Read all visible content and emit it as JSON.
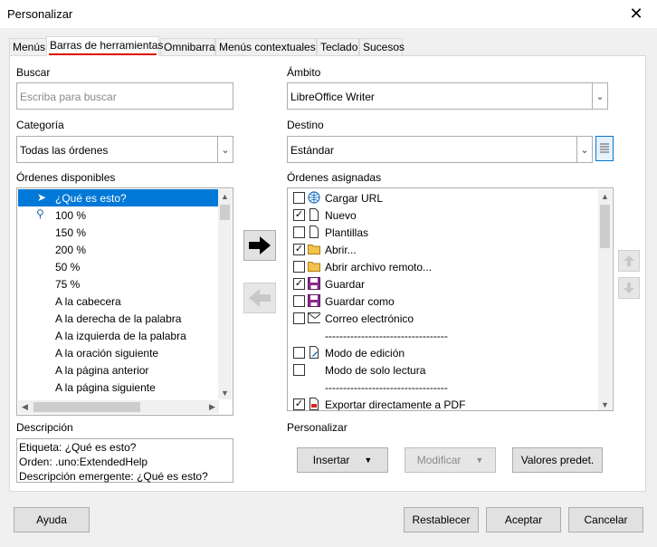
{
  "window": {
    "title": "Personalizar"
  },
  "tabs": [
    {
      "label": "Menús"
    },
    {
      "label": "Barras de herramientas"
    },
    {
      "label": "Omnibarra"
    },
    {
      "label": "Menús contextuales"
    },
    {
      "label": "Teclado"
    },
    {
      "label": "Sucesos"
    }
  ],
  "search": {
    "label": "Buscar",
    "placeholder": "Escriba para buscar"
  },
  "category": {
    "label": "Categoría",
    "value": "Todas las órdenes"
  },
  "available": {
    "label": "Órdenes disponibles",
    "items": [
      {
        "label": "¿Qué es esto?"
      },
      {
        "label": "100 %"
      },
      {
        "label": "150 %"
      },
      {
        "label": "200 %"
      },
      {
        "label": "50 %"
      },
      {
        "label": "75 %"
      },
      {
        "label": "A la cabecera"
      },
      {
        "label": "A la derecha de la palabra"
      },
      {
        "label": "A la izquierda de la palabra"
      },
      {
        "label": "A la oración siguiente"
      },
      {
        "label": "A la página anterior"
      },
      {
        "label": "A la página siguiente"
      }
    ]
  },
  "scope": {
    "label": "Ámbito",
    "value": "LibreOffice Writer"
  },
  "target": {
    "label": "Destino",
    "value": "Estándar"
  },
  "assigned": {
    "label": "Órdenes asignadas",
    "items": [
      {
        "label": "Cargar URL",
        "checked": false,
        "icon": "globe-icon"
      },
      {
        "label": "Nuevo",
        "checked": true,
        "icon": "new-document-icon"
      },
      {
        "label": "Plantillas",
        "checked": false,
        "icon": "template-icon"
      },
      {
        "label": "Abrir...",
        "checked": true,
        "icon": "folder-open-icon"
      },
      {
        "label": "Abrir archivo remoto...",
        "checked": false,
        "icon": "remote-folder-icon"
      },
      {
        "label": "Guardar",
        "checked": true,
        "icon": "save-icon"
      },
      {
        "label": "Guardar como",
        "checked": false,
        "icon": "save-as-icon"
      },
      {
        "label": "Correo electrónico",
        "checked": false,
        "icon": "mail-icon"
      },
      {
        "label": "----------------------------------",
        "checked": null,
        "icon": ""
      },
      {
        "label": "Modo de edición",
        "checked": false,
        "icon": "edit-mode-icon"
      },
      {
        "label": "Modo de solo lectura",
        "checked": false,
        "icon": ""
      },
      {
        "label": "----------------------------------",
        "checked": null,
        "icon": ""
      },
      {
        "label": "Exportar directamente a PDF",
        "checked": true,
        "icon": "pdf-icon"
      }
    ]
  },
  "description": {
    "label": "Descripción",
    "lines": [
      "Etiqueta: ¿Qué es esto?",
      "Orden: .uno:ExtendedHelp",
      "Descripción emergente: ¿Qué es esto?"
    ]
  },
  "customize": {
    "label": "Personalizar",
    "insert": "Insertar",
    "modify": "Modificar",
    "defaults": "Valores predet."
  },
  "footer": {
    "help": "Ayuda",
    "reset": "Restablecer",
    "ok": "Aceptar",
    "cancel": "Cancelar"
  },
  "colors": {
    "selection": "#0078d7",
    "tab_underline": "#dd0000"
  }
}
